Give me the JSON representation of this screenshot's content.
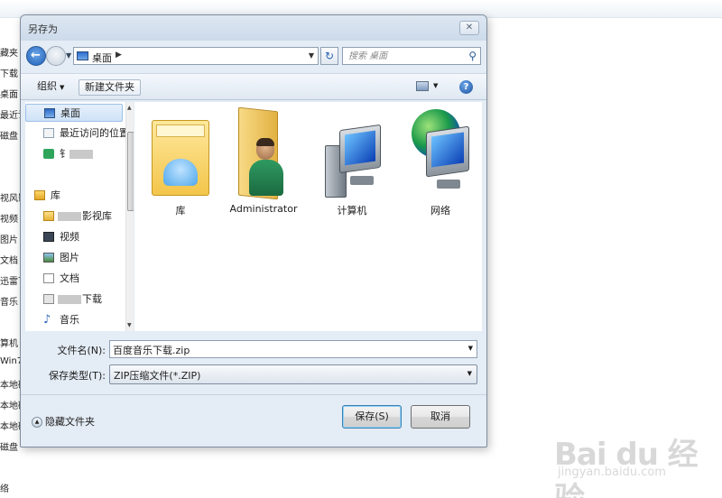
{
  "dialog": {
    "title": "另存为",
    "close_glyph": "✕"
  },
  "address_bar": {
    "location": "桌面",
    "separator_glyph": "▶",
    "dropdown_glyph": "▼",
    "refresh_glyph": "↻"
  },
  "search": {
    "placeholder": "搜索 桌面"
  },
  "toolbar": {
    "organize_label": "组织",
    "new_folder_label": "新建文件夹",
    "help_glyph": "?"
  },
  "nav_pane": {
    "items": [
      {
        "label": "桌面",
        "icon": "desktop-icon",
        "selected": true
      },
      {
        "label": "最近访问的位置",
        "icon": "recent-places-icon"
      },
      {
        "label": "钅",
        "icon": "app-icon",
        "blurred_suffix": true
      },
      {
        "label": "库",
        "icon": "library-icon"
      },
      {
        "label": "影视库",
        "icon": "folder-icon",
        "blurred_prefix": true
      },
      {
        "label": "视频",
        "icon": "video-icon"
      },
      {
        "label": "图片",
        "icon": "pictures-icon"
      },
      {
        "label": "文档",
        "icon": "documents-icon"
      },
      {
        "label": "下载",
        "icon": "downloads-icon",
        "blurred_prefix": true
      },
      {
        "label": "音乐",
        "icon": "music-icon"
      }
    ]
  },
  "content": {
    "items": [
      {
        "label": "库",
        "icon": "library-icon"
      },
      {
        "label": "Administrator",
        "icon": "user-folder-icon"
      },
      {
        "label": "计算机",
        "icon": "computer-icon"
      },
      {
        "label": "网络",
        "icon": "network-icon"
      }
    ]
  },
  "form": {
    "filename_label": "文件名(N):",
    "filename_value": "百度音乐下载.zip",
    "filetype_label": "保存类型(T):",
    "filetype_value": "ZIP压缩文件(*.ZIP)"
  },
  "footer": {
    "hide_folders_label": "隐藏文件夹",
    "save_label": "保存(S)",
    "cancel_label": "取消"
  },
  "background_window": {
    "sidebar_fragments": [
      "藏夹",
      "下载",
      "桌面",
      "最近访",
      "磁盘",
      "",
      "视风影",
      "视频",
      "图片",
      "文档",
      "迅雷下",
      "音乐",
      "",
      "算机",
      "Win7 (",
      "本地磁",
      "本地磁",
      "本地磁",
      "磁盘",
      "",
      "络"
    ]
  },
  "watermark": {
    "brand": "Bai du 经验",
    "url": "jingyan.baidu.com"
  }
}
